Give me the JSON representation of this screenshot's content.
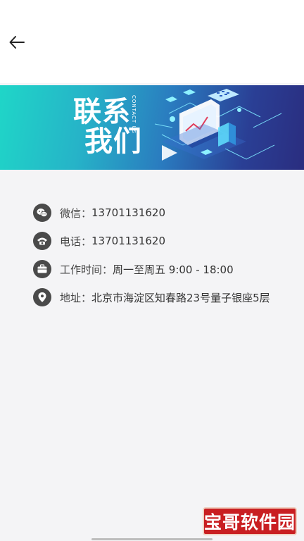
{
  "header": {
    "back_icon": "arrow-left-icon"
  },
  "banner": {
    "title_line1": "联系",
    "title_line2": "我们",
    "subtitle": "CONTACT US",
    "colors": [
      "#1fd6c8",
      "#2a7bbf",
      "#2a2d7f"
    ]
  },
  "contact": {
    "wechat": {
      "icon": "wechat-icon",
      "label": "微信：",
      "value": "13701131620"
    },
    "phone": {
      "icon": "phone-icon",
      "label": "电话：",
      "value": "13701131620"
    },
    "hours": {
      "icon": "briefcase-icon",
      "label": "工作时间：",
      "value": "周一至周五 9:00 - 18:00"
    },
    "address": {
      "icon": "location-pin-icon",
      "label": "地址：",
      "value": "北京市海淀区知春路23号量子银座5层"
    }
  },
  "watermark": {
    "text": "宝哥软件园"
  }
}
